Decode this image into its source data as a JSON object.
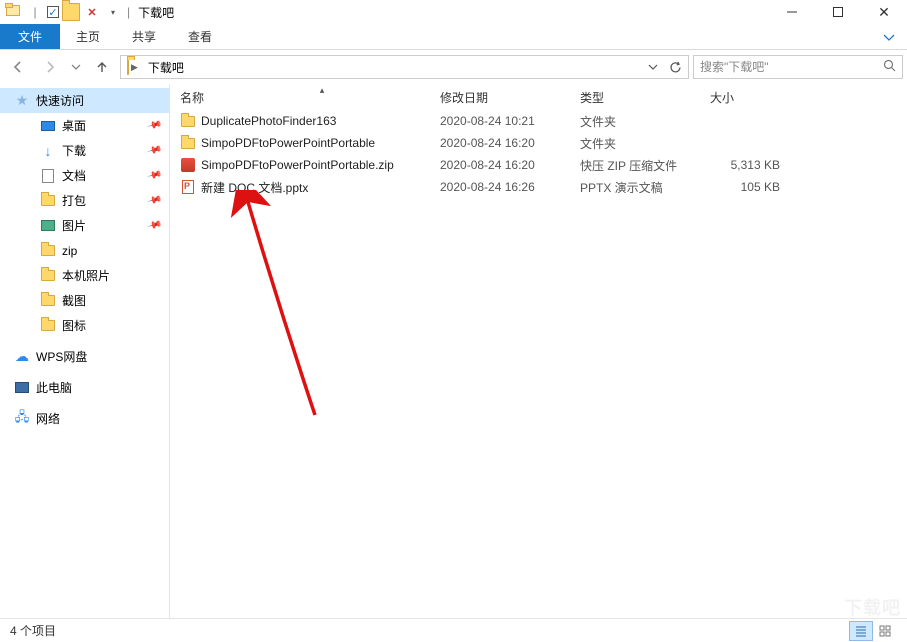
{
  "window": {
    "title": "下载吧",
    "qat_sep": "|",
    "close_x": "✕"
  },
  "ribbon": {
    "file": "文件",
    "tabs": [
      "主页",
      "共享",
      "查看"
    ]
  },
  "address": {
    "crumb0": "",
    "crumb1": "下载吧"
  },
  "search": {
    "placeholder": "搜索\"下载吧\""
  },
  "sidebar": {
    "quick": "快速访问",
    "items": [
      {
        "label": "桌面",
        "pinned": true
      },
      {
        "label": "下载",
        "pinned": true
      },
      {
        "label": "文档",
        "pinned": true
      },
      {
        "label": "打包",
        "pinned": true
      },
      {
        "label": "图片",
        "pinned": true
      },
      {
        "label": "zip",
        "pinned": false
      },
      {
        "label": "本机照片",
        "pinned": false
      },
      {
        "label": "截图",
        "pinned": false
      },
      {
        "label": "图标",
        "pinned": false
      }
    ],
    "wps": "WPS网盘",
    "thispc": "此电脑",
    "network": "网络"
  },
  "columns": {
    "name": "名称",
    "date": "修改日期",
    "type": "类型",
    "size": "大小"
  },
  "files": [
    {
      "name": "DuplicatePhotoFinder163",
      "date": "2020-08-24 10:21",
      "type": "文件夹",
      "size": "",
      "icon": "folder"
    },
    {
      "name": "SimpoPDFtoPowerPointPortable",
      "date": "2020-08-24 16:20",
      "type": "文件夹",
      "size": "",
      "icon": "folder"
    },
    {
      "name": "SimpoPDFtoPowerPointPortable.zip",
      "date": "2020-08-24 16:20",
      "type": "快压 ZIP 压缩文件",
      "size": "5,313 KB",
      "icon": "zip"
    },
    {
      "name": "新建 DOC 文档.pptx",
      "date": "2020-08-24 16:26",
      "type": "PPTX 演示文稿",
      "size": "105 KB",
      "icon": "pptx"
    }
  ],
  "status": {
    "count": "4 个项目"
  },
  "watermark": "下载吧"
}
